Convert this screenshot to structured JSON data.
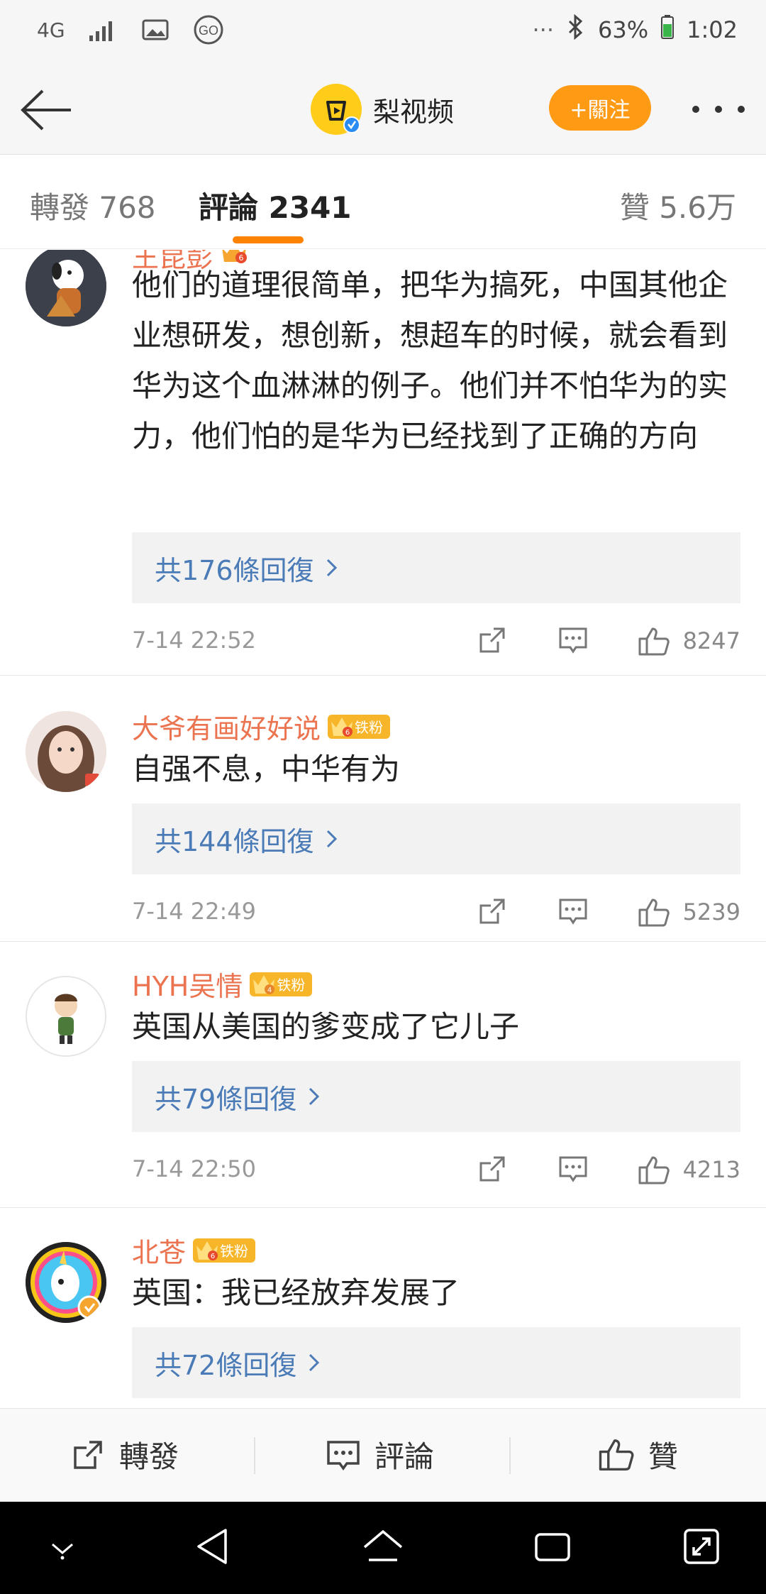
{
  "status_bar": {
    "network": "4G",
    "battery": "63%",
    "time": "1:02",
    "overflow": "···"
  },
  "header": {
    "brand_name": "梨视频",
    "follow_label": "+關注"
  },
  "tabs": [
    {
      "label": "轉發 768"
    },
    {
      "label": "評論 2341"
    },
    {
      "label": "贊 5.6万"
    }
  ],
  "comments": [
    {
      "user": "王昆彭",
      "text": "他们的道理很简单，把华为搞死，中国其他企业想研发，想创新，想超车的时候，就会看到华为这个血淋淋的例子。他们并不怕华为的实力，他们怕的是华为已经找到了正确的方向",
      "replies": "共176條回復",
      "time": "7-14 22:52",
      "likes": "8247",
      "crown_level": "6",
      "fan_badge": ""
    },
    {
      "user": "大爷有画好好说",
      "text": "自强不息，中华有为",
      "replies": "共144條回復",
      "time": "7-14 22:49",
      "likes": "5239",
      "crown_level": "6",
      "fan_badge": "铁粉"
    },
    {
      "user": "HYH吴情",
      "text": "英国从美国的爹变成了它儿子",
      "replies": "共79條回復",
      "time": "7-14 22:50",
      "likes": "4213",
      "crown_level": "4",
      "fan_badge": "铁粉"
    },
    {
      "user": "北苍",
      "text": "英国：我已经放弃发展了",
      "replies": "共72條回復",
      "time": "",
      "likes": "",
      "crown_level": "6",
      "fan_badge": "铁粉"
    }
  ],
  "bottom_bar": {
    "repost": "轉發",
    "comment": "評論",
    "like": "贊"
  },
  "colors": {
    "accent_orange": "#ff8200",
    "username": "#eb7350",
    "link_blue": "#4a7bb7",
    "follow_button": "#ff9a14"
  }
}
